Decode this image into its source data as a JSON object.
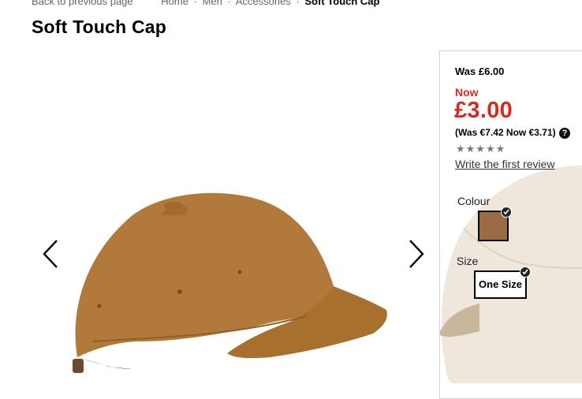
{
  "breadcrumb": {
    "back": "Back to previous page",
    "items": [
      "Home",
      "Men",
      "Accessories"
    ],
    "separator": "·",
    "current": "Soft Touch Cap"
  },
  "product": {
    "title": "Soft Touch Cap",
    "was_price": "Was £6.00",
    "now_label": "Now",
    "now_price": "£3.00",
    "euro_prices": "(Was €7.42 Now €3.71)",
    "help_icon": "?",
    "rating": {
      "value": 0,
      "max": 5,
      "stars": "★★★★★"
    },
    "review_link": "Write the first review",
    "colour_label": "Colour",
    "colour_swatch": "#9a6b45",
    "size_label": "Size",
    "size_value": "One Size"
  },
  "colors": {
    "accent_red": "#d62b1f",
    "cap_main": "#b27a3a",
    "cap_alt": "#efe7dc"
  }
}
